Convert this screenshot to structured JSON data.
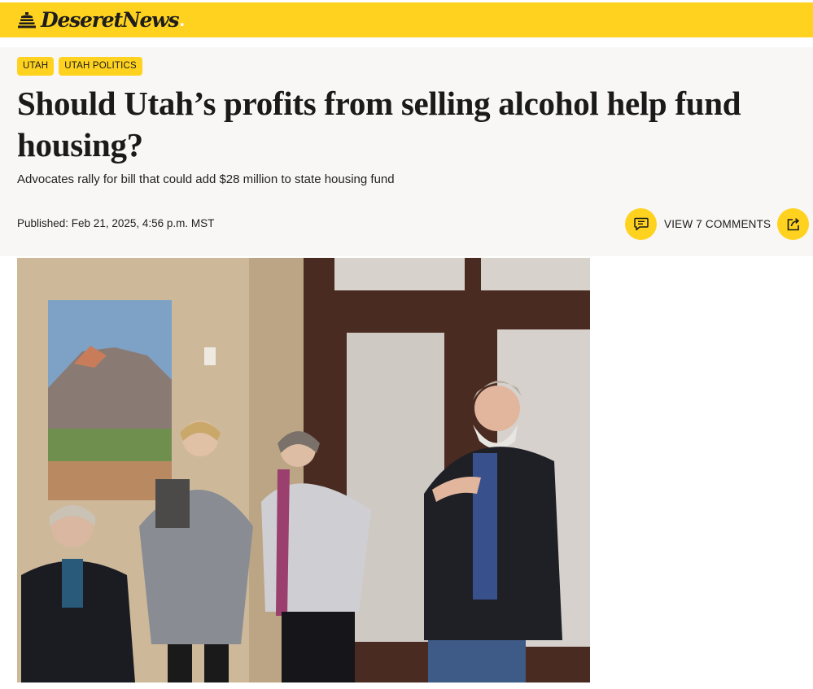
{
  "site": {
    "name": "DeseretNews",
    "dot": ".",
    "brand_color": "#ffd21f"
  },
  "article": {
    "tags": [
      "UTAH",
      "UTAH POLITICS"
    ],
    "headline": "Should Utah’s profits from selling alcohol help fund housing?",
    "subhead": "Advocates rally for bill that could add $28 million to state housing fund",
    "published": "Published: Feb 21, 2025, 4:56 p.m. MST",
    "comments_label": "VIEW 7 COMMENTS"
  },
  "icons": {
    "logo": "beehive-icon",
    "comments": "comment-icon",
    "share": "share-icon"
  }
}
